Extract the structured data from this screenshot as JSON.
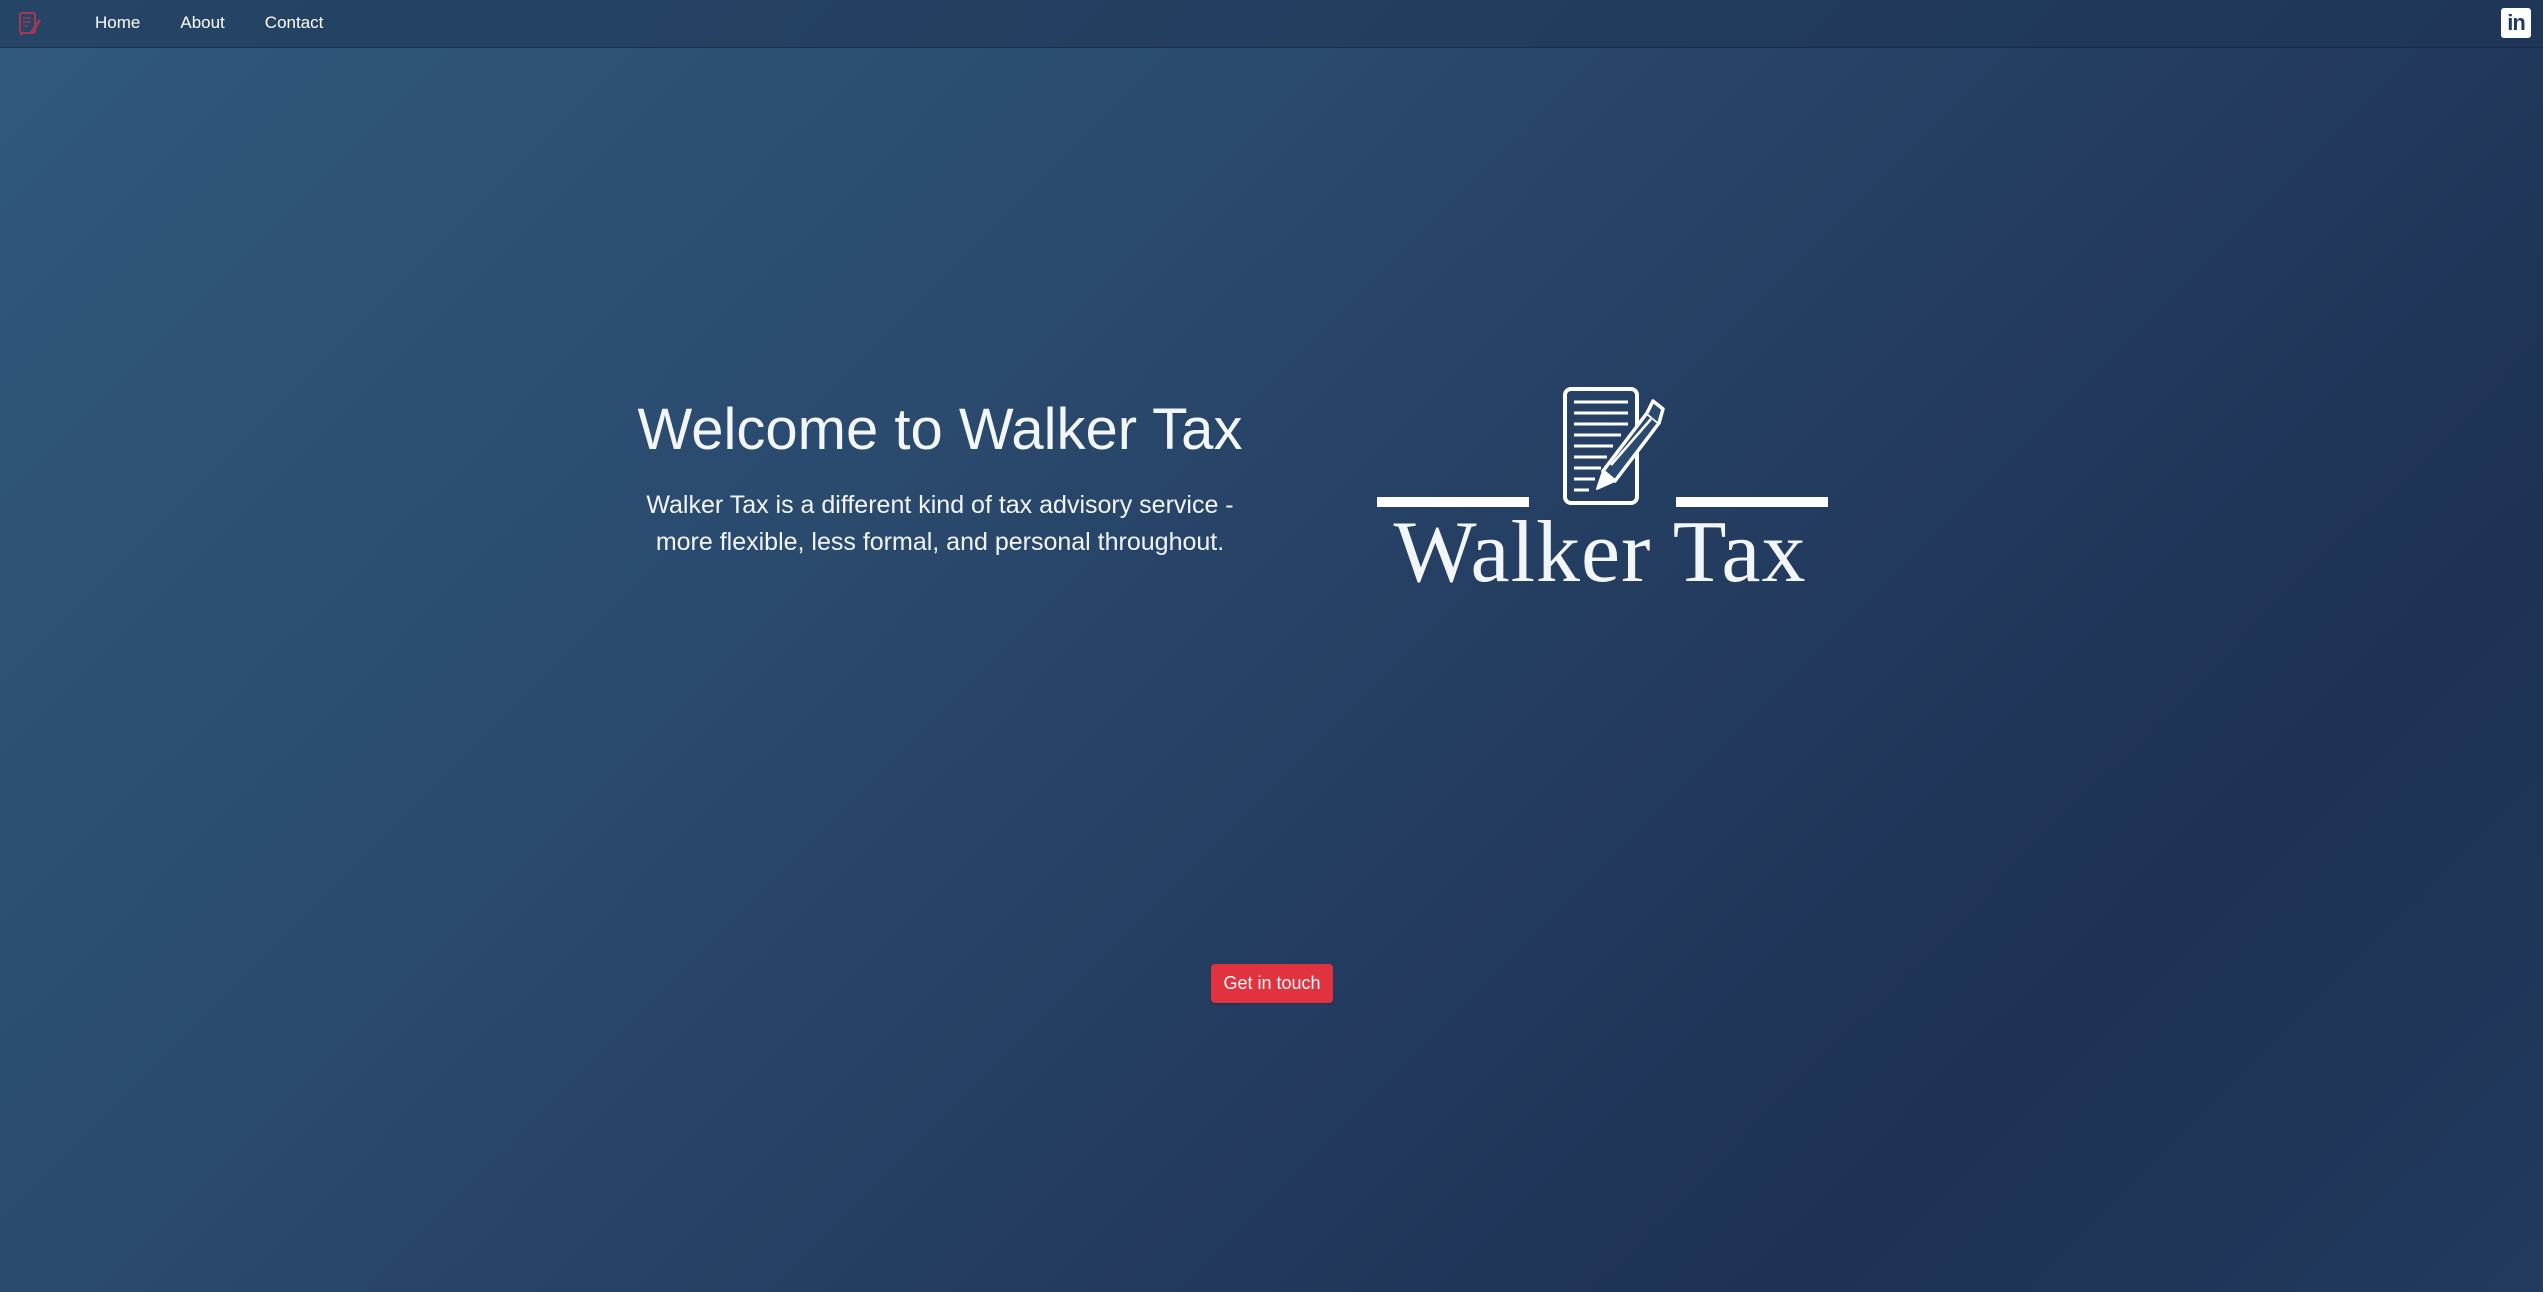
{
  "nav": {
    "brand_icon": "walker-tax-logo-icon",
    "links": [
      {
        "label": "Home"
      },
      {
        "label": "About"
      },
      {
        "label": "Contact"
      }
    ],
    "social": {
      "label": "in",
      "icon": "linkedin-icon"
    }
  },
  "hero": {
    "title": "Welcome to Walker Tax",
    "text_line1": "Walker Tax is a different kind of tax advisory service -",
    "text_line2": "more flexible, less formal, and personal throughout.",
    "logo_text": "Walker Tax",
    "logo_icon": "document-pen-icon"
  },
  "cta": {
    "label": "Get in touch",
    "color": "#e0323f"
  },
  "colors": {
    "background_start": "#30597d",
    "background_end": "#1d3254",
    "text": "#f3f6f8"
  }
}
